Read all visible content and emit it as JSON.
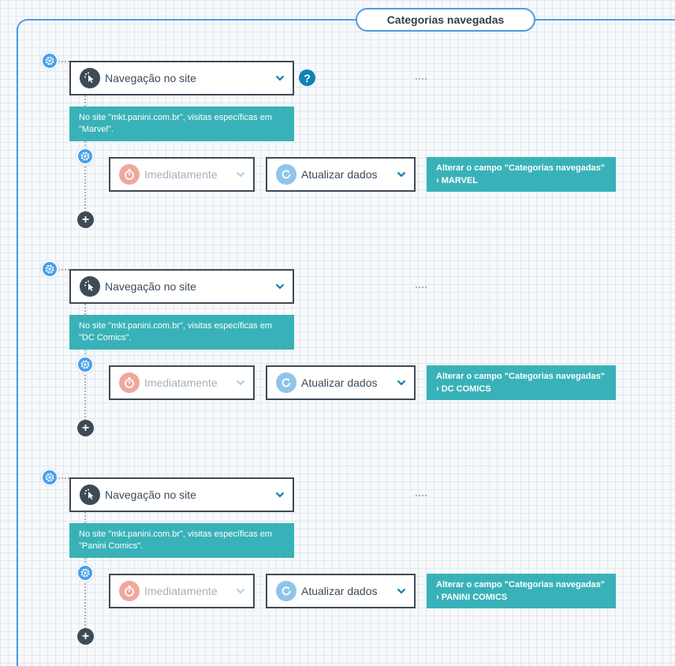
{
  "container": {
    "title": "Categorias navegadas"
  },
  "help_label": "?",
  "add_label": "+",
  "colors": {
    "accent": "#4d9be6",
    "teal": "#38b2b8",
    "dark": "#3e4a56",
    "timing_icon": "#f0a79c",
    "action_icon": "#8ec5e9",
    "help": "#0e83b5"
  },
  "groups": [
    {
      "trigger_label": "Navegação no site",
      "condition_text": "No site \"mkt.panini.com.br\", visitas específicas em \"Marvel\".",
      "timing_label": "Imediatamente",
      "action_label": "Atualizar dados",
      "result_title": "Alterar o campo \"Categorias navegadas\"",
      "result_value": "› MARVEL"
    },
    {
      "trigger_label": "Navegação no site",
      "condition_text": "No site \"mkt.panini.com.br\", visitas específicas em \"DC Comics\".",
      "timing_label": "Imediatamente",
      "action_label": "Atualizar dados",
      "result_title": "Alterar o campo \"Categorias navegadas\"",
      "result_value": "› DC COMICS"
    },
    {
      "trigger_label": "Navegação no site",
      "condition_text": "No site \"mkt.panini.com.br\", visitas específicas em \"Panini Comics\".",
      "timing_label": "Imediatamente",
      "action_label": "Atualizar dados",
      "result_title": "Alterar o campo \"Categorias navegadas\"",
      "result_value": "› PANINI COMICS"
    }
  ]
}
